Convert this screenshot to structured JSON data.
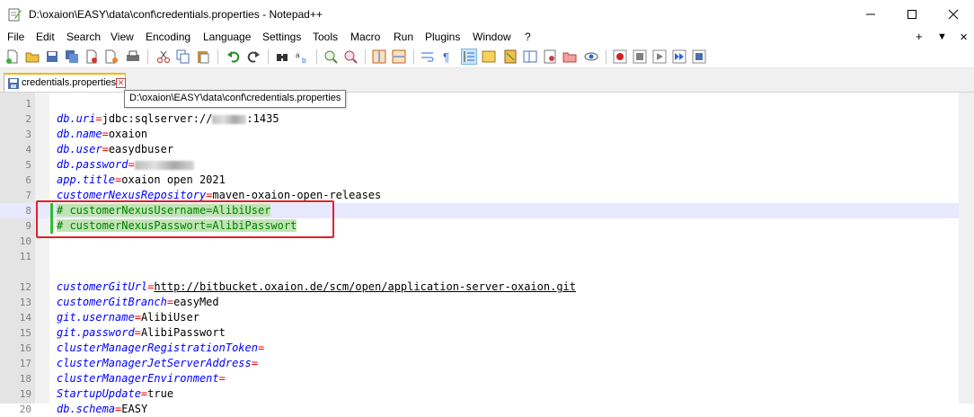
{
  "window": {
    "title": "D:\\oxaion\\EASY\\data\\conf\\credentials.properties - Notepad++",
    "minimize_glyph": "—",
    "maximize_glyph": "☐",
    "close_glyph": "✕"
  },
  "menu": {
    "items": [
      "File",
      "Edit",
      "Search",
      "View",
      "Encoding",
      "Language",
      "Settings",
      "Tools",
      "Macro",
      "Run",
      "Plugins",
      "Window",
      "?"
    ],
    "right": [
      "+",
      "▼",
      "✕"
    ]
  },
  "tab": {
    "label": "credentials.properties",
    "close_glyph": "✕",
    "tooltip": "D:\\oxaion\\EASY\\data\\conf\\credentials.properties"
  },
  "editor": {
    "line_numbers": [
      "1",
      "2",
      "3",
      "4",
      "5",
      "6",
      "7",
      "8",
      "9",
      "10",
      "11",
      "",
      "12",
      "13",
      "14",
      "15",
      "16",
      "17",
      "18",
      "19",
      "20"
    ],
    "lines": [
      {
        "key": "",
        "eq": "",
        "val": ""
      },
      {
        "key": "db.uri",
        "eq": "=",
        "val": "jdbc:sqlserver://",
        "suffix": ":1435",
        "redacted": true
      },
      {
        "key": "db.name",
        "eq": "=",
        "val": "oxaion"
      },
      {
        "key": "db.user",
        "eq": "=",
        "val": "easydbuser"
      },
      {
        "key": "db.password",
        "eq": "=",
        "val": "",
        "redacted": true
      },
      {
        "key": "app.title",
        "eq": "=",
        "val": "oxaion open 2021"
      },
      {
        "key": "customerNexusRepository",
        "eq": "=",
        "val": "maven-oxaion-open-releases"
      },
      {
        "comment": "# customerNexusUsername=AlibiUser"
      },
      {
        "comment": "# customerNexusPasswort=AlibiPasswort"
      },
      {
        "key": "",
        "eq": "",
        "val": ""
      },
      {
        "key": "",
        "eq": "",
        "val": ""
      },
      {
        "key": "customerGitUrl",
        "eq": "=",
        "val": "http://bitbucket.oxaion.de/scm/open/application-server-oxaion.git"
      },
      {
        "key": "customerGitBranch",
        "eq": "=",
        "val": "easyMed"
      },
      {
        "key": "git.username",
        "eq": "=",
        "val": "AlibiUser"
      },
      {
        "key": "git.password",
        "eq": "=",
        "val": "AlibiPasswort"
      },
      {
        "key": "clusterManagerRegistrationToken",
        "eq": "=",
        "val": ""
      },
      {
        "key": "clusterManagerJetServerAddress",
        "eq": "=",
        "val": ""
      },
      {
        "key": "clusterManagerEnvironment",
        "eq": "=",
        "val": ""
      },
      {
        "key": "StartupUpdate",
        "eq": "=",
        "val": "true"
      },
      {
        "key": "db.schema",
        "eq": "=",
        "val": "EASY"
      }
    ]
  },
  "colors": {
    "key": "#0000ff",
    "equals": "#ff0000",
    "comment": "#008000",
    "comment_bg": "#c0e4b4",
    "current_line": "#e8e8ff",
    "annotation_box": "#e0202a"
  }
}
